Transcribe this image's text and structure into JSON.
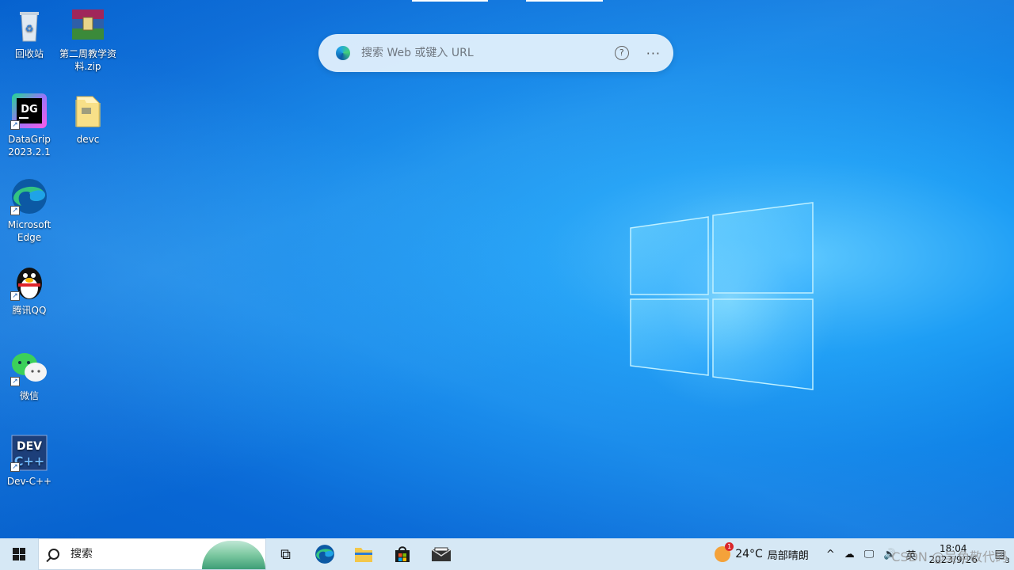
{
  "desktop": {
    "icons": [
      {
        "label": "回收站"
      },
      {
        "label": "第二周教学资料.zip"
      },
      {
        "label": "DataGrip 2023.2.1"
      },
      {
        "label": "devc"
      },
      {
        "label": "Microsoft Edge"
      },
      {
        "label": "腾讯QQ"
      },
      {
        "label": "微信"
      },
      {
        "label": "Dev-C++"
      }
    ]
  },
  "edge_search": {
    "placeholder": "搜索 Web 或键入 URL",
    "help_glyph": "?",
    "more_glyph": "···"
  },
  "taskbar": {
    "search_placeholder": "搜索",
    "weather_temp": "24°C",
    "weather_desc": "局部晴朗",
    "weather_badge": "1",
    "ime": "英",
    "clock_time": "18:04",
    "clock_date": "2023/9/26",
    "notification_count": "3",
    "watermark": "CSDN @吴角敬代码",
    "task_view_glyph": "⧉",
    "tray_chevron": "^",
    "onedrive_glyph": "☁",
    "network_glyph": "🖵",
    "volume_glyph": "🔊"
  },
  "colors": {
    "taskbar_bg": "#d6e8f5",
    "wallpaper_accent": "#0a7fe6"
  }
}
